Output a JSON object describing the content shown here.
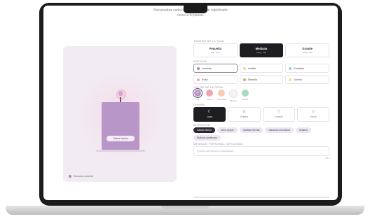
{
  "intro": {
    "line1": "Personaliza cada detalle d          y dale un significado",
    "line2": "único a tu pausa."
  },
  "preview": {
    "candle_label": "Calma interior",
    "essence_tag": "Esencia: Lavanda",
    "essence_color": "#a68bc4"
  },
  "sections": {
    "size_label": "TAMAÑO DE LA TAZA",
    "essence_label": "ESENCIA",
    "color_label": "COLOR DE LA CERA",
    "charm_label": "CHARM",
    "intention_label": "INTENCIÓN",
    "message_label": "MENSAJE PERSONAL (OPCIONAL)"
  },
  "sizes": [
    {
      "name": "Pequeña",
      "sub": "80g · 20h",
      "selected": false
    },
    {
      "name": "Mediana",
      "sub": "180g · 35h",
      "selected": true
    },
    {
      "name": "Grande",
      "sub": "300g · 60h",
      "selected": false
    }
  ],
  "essences": [
    {
      "name": "Lavanda",
      "color": "#a68bc4",
      "selected": true
    },
    {
      "name": "Vainilla",
      "color": "#f3d6b0",
      "selected": false
    },
    {
      "name": "Eucalipto",
      "color": "#9fd3b8",
      "selected": false
    },
    {
      "name": "Rosa",
      "color": "#f2a7b8",
      "selected": false
    },
    {
      "name": "Sándalo",
      "color": "#d8a86a",
      "selected": false
    },
    {
      "name": "Jazmín",
      "color": "#f1e38a",
      "selected": false
    }
  ],
  "wax_colors": [
    {
      "name": "Lila",
      "color": "#b896c7",
      "selected": true
    },
    {
      "name": "Rosa",
      "color": "#f2a5b4",
      "selected": false
    },
    {
      "name": "Melocotón",
      "color": "#f8cdb2",
      "selected": false
    },
    {
      "name": "Blanco",
      "color": "#f6f3f6",
      "selected": false
    },
    {
      "name": "Menta",
      "color": "#a8dcc0",
      "selected": false
    }
  ],
  "charms": [
    {
      "name": "Luna",
      "icon": "moon-icon",
      "glyph": "☾",
      "selected": true
    },
    {
      "name": "Estrella",
      "icon": "star-icon",
      "glyph": "☆",
      "selected": false
    },
    {
      "name": "Corazón",
      "icon": "heart-icon",
      "glyph": "♡",
      "selected": false
    },
    {
      "name": "Círculo",
      "icon": "circle-icon",
      "glyph": "○",
      "selected": false
    }
  ],
  "intentions": [
    {
      "name": "Calma interior",
      "selected": true
    },
    {
      "name": "Amor propio",
      "selected": false
    },
    {
      "name": "Claridad mental",
      "selected": false
    },
    {
      "name": "Sanación emocional",
      "selected": false
    },
    {
      "name": "Gratitud",
      "selected": false
    },
    {
      "name": "Nuevos comienzos",
      "selected": false
    }
  ],
  "message": {
    "placeholder": "Escribe una intención o dedicatoria...",
    "counter": "0/80"
  }
}
